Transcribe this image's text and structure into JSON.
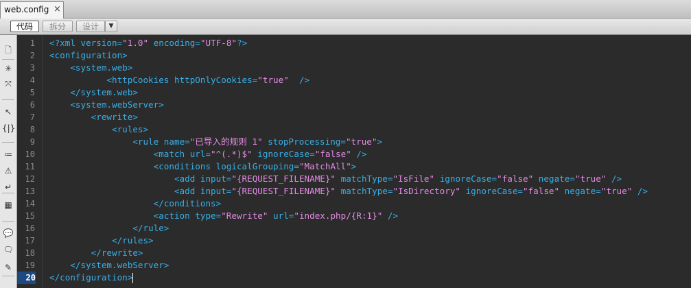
{
  "tab": {
    "label": "web.config",
    "close": "×"
  },
  "toolbar": {
    "code": "代码",
    "split": "拆分",
    "design": "设计",
    "arrow": "▼"
  },
  "sidebar_icons": [
    {
      "name": "open-documents-icon",
      "glyph": "🗋"
    },
    {
      "name": "collapse-icon",
      "glyph": "✳"
    },
    {
      "name": "expand-all-icon",
      "glyph": "⤧"
    },
    {
      "name": "select-parent-tag-icon",
      "glyph": "↖"
    },
    {
      "name": "balance-braces-icon",
      "glyph": "{|}"
    },
    {
      "name": "line-numbers-icon",
      "glyph": "≔"
    },
    {
      "name": "highlight-invalid-code-icon",
      "glyph": "⚠"
    },
    {
      "name": "word-wrap-icon",
      "glyph": "↵"
    },
    {
      "name": "syntax-error-icon",
      "glyph": "▦"
    },
    {
      "name": "apply-comment-icon",
      "glyph": "💬"
    },
    {
      "name": "remove-comment-icon",
      "glyph": "🗨"
    },
    {
      "name": "wrap-tag-icon",
      "glyph": "✎"
    },
    {
      "name": "recent-snippets-icon",
      "glyph": "⚙"
    }
  ],
  "editor": {
    "current_line": 20,
    "lines": [
      [
        {
          "t": "<?xml version=",
          "c": "t"
        },
        {
          "t": "\"1.0\"",
          "c": "v"
        },
        {
          "t": " encoding=",
          "c": "t"
        },
        {
          "t": "\"UTF-8\"",
          "c": "v"
        },
        {
          "t": "?>",
          "c": "t"
        }
      ],
      [
        {
          "t": "<configuration>",
          "c": "t"
        }
      ],
      [
        {
          "t": "    <system.web>",
          "c": "t"
        }
      ],
      [
        {
          "t": "           <httpCookies httpOnlyCookies=",
          "c": "t"
        },
        {
          "t": "\"true\"",
          "c": "v"
        },
        {
          "t": "  />",
          "c": "t"
        }
      ],
      [
        {
          "t": "    </system.web>",
          "c": "t"
        }
      ],
      [
        {
          "t": "    <system.webServer>",
          "c": "t"
        }
      ],
      [
        {
          "t": "        <rewrite>",
          "c": "t"
        }
      ],
      [
        {
          "t": "            <rules>",
          "c": "t"
        }
      ],
      [
        {
          "t": "                <rule name=",
          "c": "t"
        },
        {
          "t": "\"已导入的规则 1\"",
          "c": "v"
        },
        {
          "t": " stopProcessing=",
          "c": "t"
        },
        {
          "t": "\"true\"",
          "c": "v"
        },
        {
          "t": ">",
          "c": "t"
        }
      ],
      [
        {
          "t": "                    <match url=",
          "c": "t"
        },
        {
          "t": "\"^(.*)$\"",
          "c": "v"
        },
        {
          "t": " ignoreCase=",
          "c": "t"
        },
        {
          "t": "\"false\"",
          "c": "v"
        },
        {
          "t": " />",
          "c": "t"
        }
      ],
      [
        {
          "t": "                    <conditions logicalGrouping=",
          "c": "t"
        },
        {
          "t": "\"MatchAll\"",
          "c": "v"
        },
        {
          "t": ">",
          "c": "t"
        }
      ],
      [
        {
          "t": "                        <add input=",
          "c": "t"
        },
        {
          "t": "\"{REQUEST_FILENAME}\"",
          "c": "v"
        },
        {
          "t": " matchType=",
          "c": "t"
        },
        {
          "t": "\"IsFile\"",
          "c": "v"
        },
        {
          "t": " ignoreCase=",
          "c": "t"
        },
        {
          "t": "\"false\"",
          "c": "v"
        },
        {
          "t": " negate=",
          "c": "t"
        },
        {
          "t": "\"true\"",
          "c": "v"
        },
        {
          "t": " />",
          "c": "t"
        }
      ],
      [
        {
          "t": "                        <add input=",
          "c": "t"
        },
        {
          "t": "\"{REQUEST_FILENAME}\"",
          "c": "v"
        },
        {
          "t": " matchType=",
          "c": "t"
        },
        {
          "t": "\"IsDirectory\"",
          "c": "v"
        },
        {
          "t": " ignoreCase=",
          "c": "t"
        },
        {
          "t": "\"false\"",
          "c": "v"
        },
        {
          "t": " negate=",
          "c": "t"
        },
        {
          "t": "\"true\"",
          "c": "v"
        },
        {
          "t": " />",
          "c": "t"
        }
      ],
      [
        {
          "t": "                    </conditions>",
          "c": "t"
        }
      ],
      [
        {
          "t": "                    <action type=",
          "c": "t"
        },
        {
          "t": "\"Rewrite\"",
          "c": "v"
        },
        {
          "t": " url=",
          "c": "t"
        },
        {
          "t": "\"index.php/{R:1}\"",
          "c": "v"
        },
        {
          "t": " />",
          "c": "t"
        }
      ],
      [
        {
          "t": "                </rule>",
          "c": "t"
        }
      ],
      [
        {
          "t": "            </rules>",
          "c": "t"
        }
      ],
      [
        {
          "t": "        </rewrite>",
          "c": "t"
        }
      ],
      [
        {
          "t": "    </system.webServer>",
          "c": "t"
        }
      ],
      [
        {
          "t": "</configuration>",
          "c": "t"
        }
      ]
    ]
  },
  "colors": {
    "tag": "#37b0e8",
    "value": "#e68be6",
    "background": "#2b2b2b",
    "current_line_number": "#1f4a80"
  }
}
